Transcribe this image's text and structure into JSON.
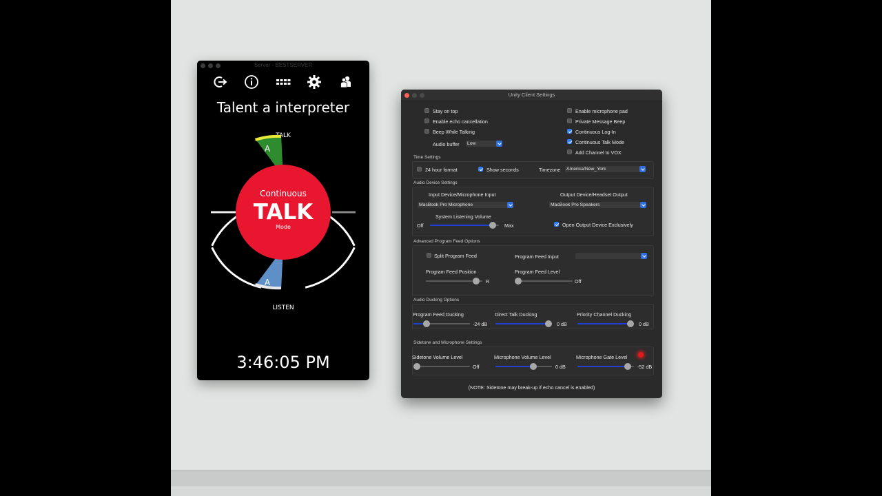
{
  "server": {
    "title": "Server - BESTSERVER",
    "talent_title": "Talent a interpreter",
    "talk_label": "TALK",
    "listen_label": "LISTEN",
    "channel_letter_top": "A",
    "channel_letter_bottom": "A",
    "center_top": "Continuous",
    "center_main": "TALK",
    "center_bottom": "Mode",
    "clock": "3:46:05 PM",
    "icons": [
      "logout-icon",
      "info-icon",
      "keypad-icon",
      "gear-icon",
      "users-icon"
    ],
    "colors": {
      "talk_segment": "#2e8b2e",
      "talk_segment_top": "#e8e83a",
      "listen_segment": "#5e8fc7",
      "center": "#e8162f"
    }
  },
  "settings": {
    "title": "Unity Client Settings",
    "general": {
      "stay_on_top": {
        "label": "Stay on top",
        "checked": false
      },
      "echo_cancel": {
        "label": "Enable echo cancellation",
        "checked": false
      },
      "beep_talking": {
        "label": "Beep While Talking",
        "checked": false
      },
      "audio_buffer_label": "Audio buffer",
      "audio_buffer_value": "Low",
      "mic_pad": {
        "label": "Enable microphone pad",
        "checked": false
      },
      "pm_beep": {
        "label": "Private Message Beep",
        "checked": false
      },
      "continuous_login": {
        "label": "Continuous Log-In",
        "checked": true
      },
      "continuous_talk": {
        "label": "Continuous Talk Mode",
        "checked": true
      },
      "add_vox": {
        "label": "Add Channel to VOX",
        "checked": false
      }
    },
    "time": {
      "title": "Time Settings",
      "hour24": {
        "label": "24 hour format",
        "checked": false
      },
      "show_seconds": {
        "label": "Show seconds",
        "checked": true
      },
      "timezone_label": "Timezone",
      "timezone_value": "America/New_York"
    },
    "audio_device": {
      "title": "Audio Device Settings",
      "input_label": "Input Device/Microphone Input",
      "input_value": "MacBook Pro Microphone",
      "output_label": "Output Device/Headset Output",
      "output_value": "MacBook Pro Speakers",
      "listening_label": "System Listening Volume",
      "listening_min": "Off",
      "listening_max": "Max",
      "listening_level": 0.95,
      "exclusive": {
        "label": "Open Output Device Exclusively",
        "checked": true
      }
    },
    "program_feed": {
      "title": "Advanced Program Feed Options",
      "split": {
        "label": "Split Program Feed",
        "checked": false
      },
      "input_label": "Program Feed Input",
      "input_value": "",
      "position_label": "Program Feed Position",
      "position_end": "R",
      "position_level": 0.95,
      "level_label": "Program Feed Level",
      "level_end": "Off",
      "level_level": 0.0
    },
    "ducking": {
      "title": "Audio Ducking Options",
      "program": {
        "label": "Program Feed Ducking",
        "value": "-24 dB",
        "level": 0.2
      },
      "direct": {
        "label": "Direct Talk Ducking",
        "value": "0 dB",
        "level": 1.0
      },
      "priority": {
        "label": "Priority Channel Ducking",
        "value": "0 dB",
        "level": 1.0
      }
    },
    "sidetone": {
      "title": "Sidetone and Microphone Settings",
      "sidetone": {
        "label": "Sidetone Volume Level",
        "value": "Off",
        "level": 0.0
      },
      "mic_volume": {
        "label": "Microphone Volume Level",
        "value": "0 dB",
        "level": 0.7
      },
      "mic_gate": {
        "label": "Microphone Gate Level",
        "value": "-52 dB",
        "level": 0.95
      }
    },
    "note": "(NOTE: Sidetone may break-up if echo cancel is enabled)"
  }
}
